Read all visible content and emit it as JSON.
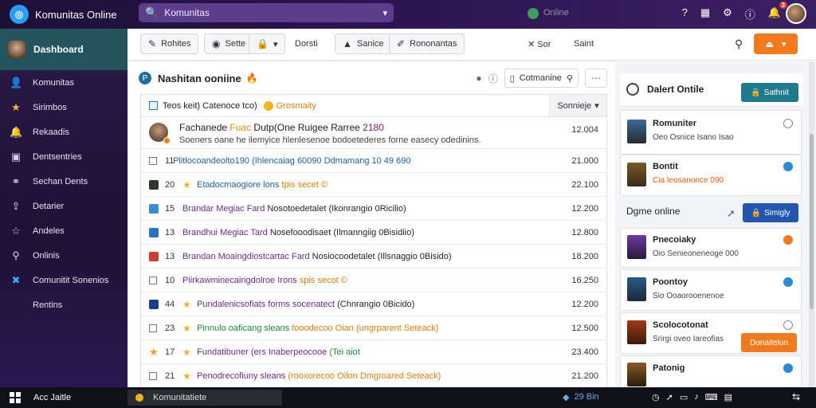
{
  "app": {
    "title": "Komunitas Online"
  },
  "search": {
    "text": "Komunitas"
  },
  "status": {
    "text": "Online"
  },
  "topbar_icons": [
    "help-icon",
    "grid-icon",
    "gear-icon",
    "info-icon",
    "bell-icon"
  ],
  "topbar_badge": "3",
  "sidebar": {
    "header": "Dashboard",
    "items": [
      {
        "label": "Komunitas",
        "icon": "person-icon"
      },
      {
        "label": "Sirimbos",
        "icon": "star-icon"
      },
      {
        "label": "Rekaadis",
        "icon": "bell-icon"
      },
      {
        "label": "Dentsentries",
        "icon": "document-icon"
      },
      {
        "label": "Sechan Dents",
        "icon": "link-icon"
      },
      {
        "label": "Detarier",
        "icon": "upload-icon"
      },
      {
        "label": "Andeles",
        "icon": "star-outline-icon"
      },
      {
        "label": "Onlinis",
        "icon": "network-icon"
      },
      {
        "label": "Comunitit Sonenios",
        "icon": "tools-icon"
      },
      {
        "label": "Rentins",
        "icon": ""
      }
    ]
  },
  "toolbar": {
    "btn1": "Rohites",
    "btn2": "Sette",
    "btn3": "Dorsti",
    "btn4": "Sanice",
    "btn5": "Rononantas",
    "btn6": "Sor",
    "btn7": "Saint"
  },
  "main": {
    "title": "Nashitan ooniine",
    "combo": "Cotmanine",
    "filter": {
      "text": "Teos keit) Catenoce tco)",
      "highlight": "Grosmaity",
      "sort": "Sonnieje"
    },
    "featured": {
      "part1": "Fachanede ",
      "part2": "Fuac ",
      "part3": "Dutp(One Ruigee Rarree",
      "part4": " 2180",
      "line2": "Soeners oane he ilemyice hlenlesenoe bodoetederes forne easecy odedinins.",
      "value": "12.004"
    },
    "rows": [
      {
        "n": "11",
        "lead": "box",
        "star": false,
        "a": "Plitlocoandeolto190 (Ihlencaiag 60090 Ddmamang 10 49 690",
        "b": "",
        "val": "21.000"
      },
      {
        "n": "20",
        "lead": "img-dark",
        "star": true,
        "a": "Etadocmaogiore lons ",
        "b": "tpis secet ©",
        "val": "22.100"
      },
      {
        "n": "15",
        "lead": "img-blue",
        "star": false,
        "a": "Brandar Megiac Fard ",
        "b": "Nosotoedetalet (Ikonrangio 0Ricilio)",
        "val": "12.200"
      },
      {
        "n": "13",
        "lead": "img-blue2",
        "star": false,
        "a": "Brandhui Megiac Tard ",
        "b": "Nosefooodisaet (Ilmanngiig 0Bisidiio)",
        "val": "12.800"
      },
      {
        "n": "13",
        "lead": "img-red",
        "star": false,
        "a": "Brandan Moaingdiostcartac Fard ",
        "b": "Nosiocoodetalet (Illsnaggio 0Bisido)",
        "val": "18.200"
      },
      {
        "n": "10",
        "lead": "box",
        "star": false,
        "a": "Piirkawminecaingdolroe Irons ",
        "b": "spis secot ©",
        "val": "16.250"
      },
      {
        "n": "44",
        "lead": "img-flag",
        "star": true,
        "a": "Pundalenicsofiats forms socenatect ",
        "b": "(Chnrangio 0Bicido)",
        "val": "12.200"
      },
      {
        "n": "23",
        "lead": "box",
        "star": true,
        "a": "Pinnulo oaficang sleans ",
        "b": "fooodecoo Oian (ungrparent Seteack)",
        "val": "12.500"
      },
      {
        "n": "17",
        "lead": "star",
        "star": true,
        "a": "Fundatibuner (ers Inaberpeocooe ",
        "b": "(Tei aiot",
        "val": "23.400"
      },
      {
        "n": "21",
        "lead": "box",
        "star": true,
        "a": "Penodrecofiuny sleans ",
        "b": "(rooxorecoo Oilon Dmgroared Seteack)",
        "val": "21.200"
      }
    ]
  },
  "right": {
    "title": "Dalert Ontile",
    "top_btn": "Sathnit",
    "cards_top": [
      {
        "name": "Romuniter",
        "sub": "Oeo Osnice Isano Isao",
        "radio": "empty"
      },
      {
        "name": "Bontit",
        "sub": "Cia Ieosanonce 090",
        "radio": "blue"
      }
    ],
    "section": "Dgme online",
    "section_btn": "Simigly",
    "cards_bottom": [
      {
        "name": "Pnecoiaky",
        "sub": "Oio Senieoneneoge 000",
        "radio": "orange"
      },
      {
        "name": "Poontoy",
        "sub": "Sio Ooaorooenenoe",
        "radio": "blue"
      },
      {
        "name": "Scolocotonat",
        "sub": "Srirgi oveo Iareofias",
        "radio": "empty"
      },
      {
        "name": "Patonig",
        "sub": "",
        "radio": "blue"
      }
    ],
    "orange_btn": "Donaitelun"
  },
  "taskbar": {
    "app": "Acc Jaitle",
    "task": "Komunitatiete",
    "tray_a": "29 Bin",
    "tray_b": [
      "clock-icon",
      "wifi-icon",
      "battery-icon",
      "volume-icon",
      "keyboard-icon",
      "notifications-icon"
    ]
  },
  "colors": {
    "accent_orange": "#f07a1e",
    "teal": "#1f7a8c",
    "blue": "#2456b0",
    "sidebar": "#2a1848"
  }
}
